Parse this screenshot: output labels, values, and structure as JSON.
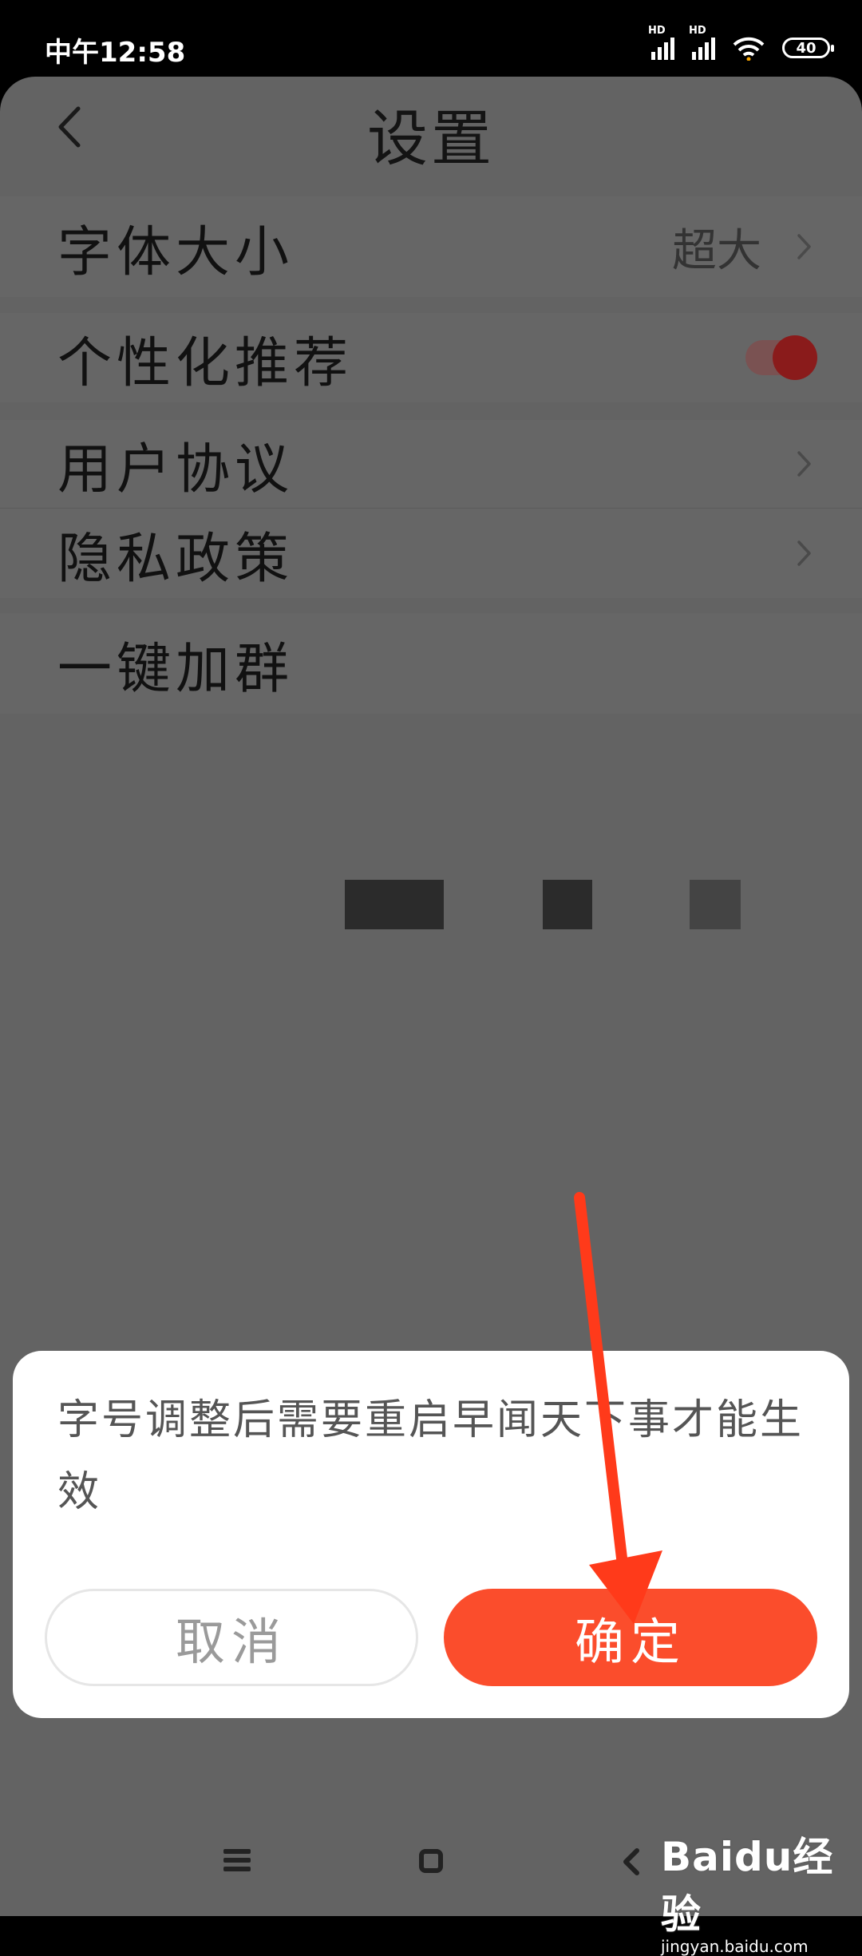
{
  "status_bar": {
    "time": "中午12:58",
    "signal1_label": "HD",
    "signal2_label": "HD",
    "battery": "40"
  },
  "header": {
    "title": "设置"
  },
  "settings": {
    "font_size": {
      "label": "字体大小",
      "value": "超大"
    },
    "personalized": {
      "label": "个性化推荐",
      "enabled": true
    },
    "user_agreement": {
      "label": "用户协议"
    },
    "privacy_policy": {
      "label": "隐私政策"
    },
    "join_group": {
      "label": "一键加群"
    }
  },
  "dialog": {
    "message": "字号调整后需要重启早闻天下事才能生效",
    "cancel_label": "取消",
    "confirm_label": "确定"
  },
  "watermark": {
    "brand": "Baidu经验",
    "url": "jingyan.baidu.com"
  },
  "colors": {
    "accent": "#fb4d2c",
    "toggle_on": "#8a1b1b",
    "annotation_arrow": "#ff3a1a"
  }
}
